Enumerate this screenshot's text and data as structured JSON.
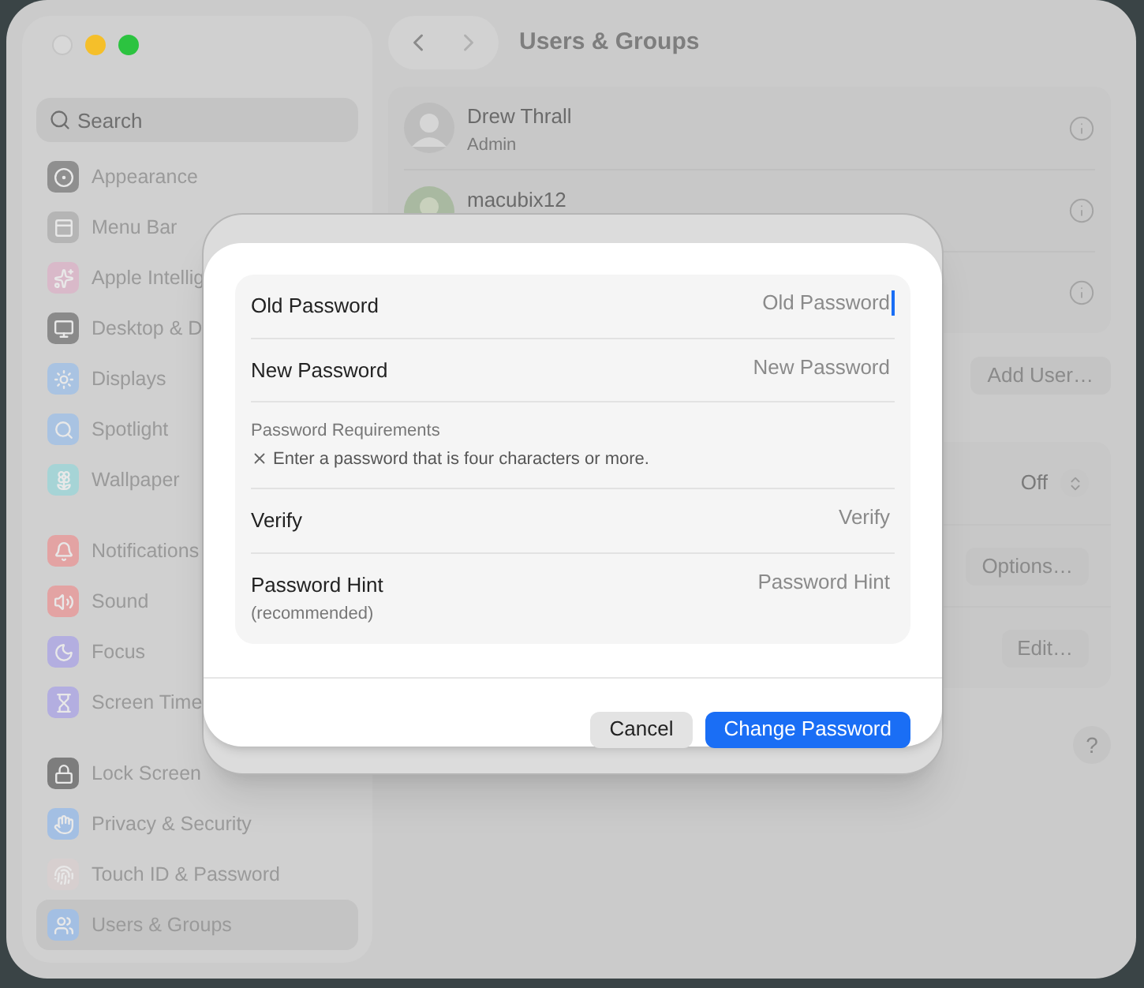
{
  "window": {
    "title": "Users & Groups"
  },
  "sidebar": {
    "search": {
      "placeholder": "Search"
    },
    "groups": [
      [
        {
          "label": "Appearance",
          "kind": "appearance",
          "selected": false
        },
        {
          "label": "Menu Bar",
          "kind": "menubar",
          "selected": false
        },
        {
          "label": "Apple Intellig",
          "kind": "intelligence",
          "selected": false
        },
        {
          "label": "Desktop & D",
          "kind": "desktop",
          "selected": false
        },
        {
          "label": "Displays",
          "kind": "displays",
          "selected": false
        },
        {
          "label": "Spotlight",
          "kind": "spotlight",
          "selected": false
        },
        {
          "label": "Wallpaper",
          "kind": "wallpaper",
          "selected": false
        }
      ],
      [
        {
          "label": "Notifications",
          "kind": "notifications",
          "selected": false
        },
        {
          "label": "Sound",
          "kind": "sound",
          "selected": false
        },
        {
          "label": "Focus",
          "kind": "focus",
          "selected": false
        },
        {
          "label": "Screen Time",
          "kind": "screentime",
          "selected": false
        }
      ],
      [
        {
          "label": "Lock Screen",
          "kind": "lock",
          "selected": false
        },
        {
          "label": "Privacy & Security",
          "kind": "privacy",
          "selected": false
        },
        {
          "label": "Touch ID & Password",
          "kind": "touchid",
          "selected": false
        },
        {
          "label": "Users & Groups",
          "kind": "users",
          "selected": true
        }
      ]
    ]
  },
  "users": [
    {
      "name": "Drew Thrall",
      "role": "Admin"
    },
    {
      "name": "macubix12"
    }
  ],
  "add_user_button": "Add User…",
  "settings": [
    {
      "kind": "stepper",
      "value": "Off"
    },
    {
      "kind": "button",
      "label": "Options…"
    },
    {
      "kind": "button",
      "label": "Edit…"
    }
  ],
  "help_button": "?",
  "dialog": {
    "rows": [
      {
        "kind": "field",
        "label": "Old Password",
        "placeholder": "Old Password",
        "focused": true
      },
      {
        "kind": "field",
        "label": "New Password",
        "placeholder": "New Password",
        "focused": false
      },
      {
        "kind": "requirements",
        "title": "Password Requirements",
        "items": [
          {
            "text": "Enter a password that is four characters or more.",
            "met": false
          }
        ]
      },
      {
        "kind": "field",
        "label": "Verify",
        "placeholder": "Verify",
        "focused": false
      },
      {
        "kind": "field",
        "label": "Password Hint",
        "note": "(recommended)",
        "placeholder": "Password Hint",
        "focused": false
      }
    ],
    "buttons": [
      {
        "label": "Cancel",
        "primary": false
      },
      {
        "label": "Change Password",
        "primary": true
      }
    ]
  }
}
